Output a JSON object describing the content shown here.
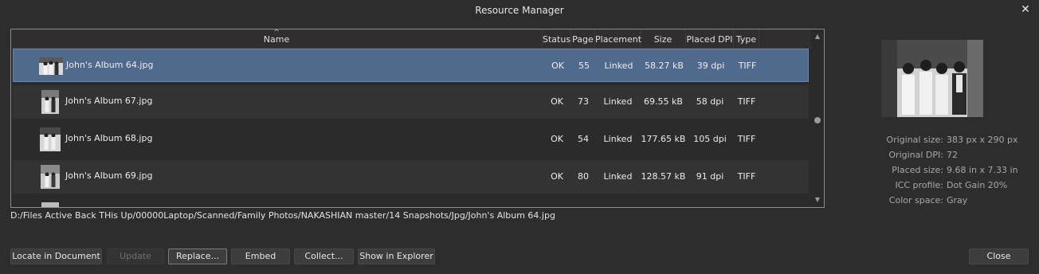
{
  "window": {
    "title": "Resource Manager",
    "close_glyph": "✕"
  },
  "table": {
    "sort_indicator": "^",
    "columns": [
      "Name",
      "Status",
      "Page",
      "Placement",
      "Size",
      "Placed DPI",
      "Type"
    ],
    "rows": [
      {
        "name": "John's Album 64.jpg",
        "status": "OK",
        "page": "55",
        "placement": "Linked",
        "size": "58.27 kB",
        "dpi": "39 dpi",
        "type": "TIFF",
        "selected": true
      },
      {
        "name": "John's Album 67.jpg",
        "status": "OK",
        "page": "73",
        "placement": "Linked",
        "size": "69.55 kB",
        "dpi": "58 dpi",
        "type": "TIFF",
        "selected": false
      },
      {
        "name": "John's Album 68.jpg",
        "status": "OK",
        "page": "54",
        "placement": "Linked",
        "size": "177.65 kB",
        "dpi": "105 dpi",
        "type": "TIFF",
        "selected": false
      },
      {
        "name": "John's Album 69.jpg",
        "status": "OK",
        "page": "80",
        "placement": "Linked",
        "size": "128.57 kB",
        "dpi": "91 dpi",
        "type": "TIFF",
        "selected": false
      }
    ]
  },
  "scrollbar": {
    "up_glyph": "▲",
    "down_glyph": "▼"
  },
  "path": "D:/Files Active Back THis Up/00000Laptop/Scanned/Family Photos/NAKASHIAN master/14 Snapshots/Jpg/John's Album 64.jpg",
  "info": {
    "original_size_label": "Original size:",
    "original_size": "383 px x 290 px",
    "original_dpi_label": "Original DPI:",
    "original_dpi": "72",
    "placed_size_label": "Placed size:",
    "placed_size": "9.68 in x 7.33 in",
    "icc_label": "ICC profile:",
    "icc": "Dot Gain 20%",
    "color_space_label": "Color space:",
    "color_space": "Gray"
  },
  "buttons": {
    "locate": "Locate in Document",
    "update": "Update",
    "replace": "Replace...",
    "embed": "Embed",
    "collect": "Collect...",
    "show_in_explorer": "Show in Explorer",
    "close": "Close"
  },
  "colors": {
    "selected_row": "#4f6a8c",
    "background": "#2d2d2d"
  }
}
